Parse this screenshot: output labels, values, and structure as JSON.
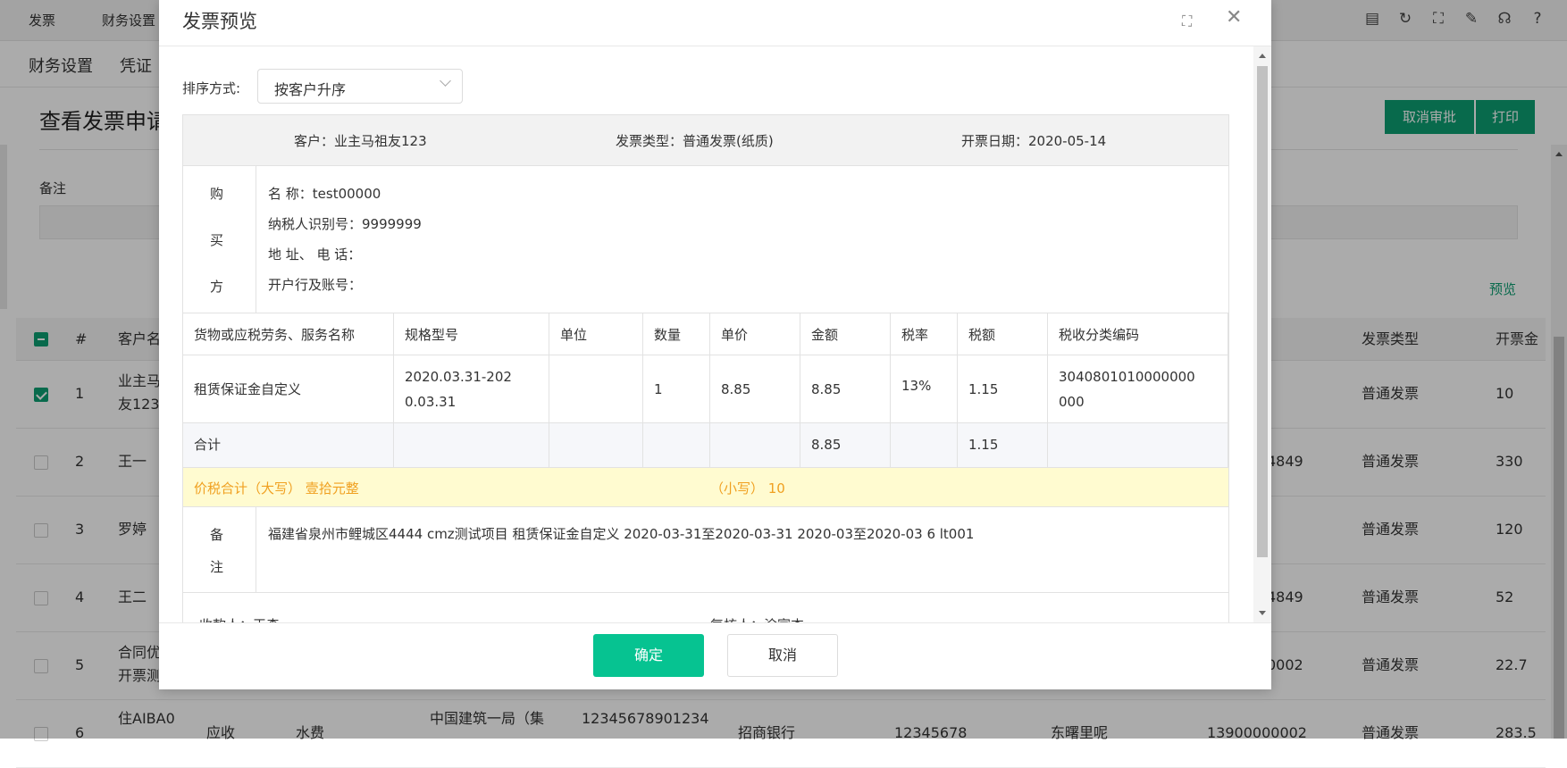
{
  "topnav": {
    "items": [
      "发票",
      "财务设置"
    ]
  },
  "subnav": {
    "items": [
      "财务设置",
      "凭证"
    ]
  },
  "page": {
    "title": "查看发票申请",
    "cancel_approve": "取消审批",
    "print": "打印",
    "remark_label": "备注",
    "preview_link": "预览"
  },
  "bg_table": {
    "headers": {
      "num": "#",
      "customer": "客户名",
      "invoice_type": "发票类型",
      "amount": "开票金"
    },
    "rows": [
      {
        "num": "1",
        "customer": [
          "业主马",
          "友123"
        ],
        "extra": "",
        "invoice_type": "普通发票",
        "amount": "10",
        "checked": true
      },
      {
        "num": "2",
        "customer": [
          "王一"
        ],
        "extra": "4849",
        "invoice_type": "普通发票",
        "amount": "330",
        "checked": false
      },
      {
        "num": "3",
        "customer": [
          "罗婷"
        ],
        "extra": "",
        "invoice_type": "普通发票",
        "amount": "120",
        "checked": false
      },
      {
        "num": "4",
        "customer": [
          "王二"
        ],
        "extra": "4849",
        "invoice_type": "普通发票",
        "amount": "52",
        "checked": false
      },
      {
        "num": "5",
        "customer": [
          "合同优",
          "开票测"
        ],
        "extra": "0002",
        "invoice_type": "普通发票",
        "amount": "22.7",
        "checked": false
      },
      {
        "num": "6",
        "customer": [
          "住AIBA0"
        ],
        "extra": "13900000002",
        "invoice_type": "普通发票",
        "amount": "283.5",
        "checked": false,
        "cols": [
          "应收",
          "水费",
          "中国建筑一局（集",
          "12345678901234",
          "招商银行",
          "12345678",
          "东曙里呢"
        ]
      }
    ]
  },
  "modal": {
    "title": "发票预览",
    "sort_label": "排序方式:",
    "sort_value": "按客户升序",
    "invoice": {
      "customer": "客户：业主马祖友123",
      "type": "发票类型：普通发票(纸质)",
      "date": "开票日期：2020-05-14",
      "buyer_side": [
        "购",
        "买",
        "方"
      ],
      "buyer": {
        "name": "名  称：test00000",
        "tax_id": "纳税人识别号：9999999",
        "address": "地  址、 电  话：",
        "bank": "开户行及账号："
      },
      "columns": [
        "货物或应税劳务、服务名称",
        "规格型号",
        "单位",
        "数量",
        "单价",
        "金额",
        "税率",
        "税额",
        "税收分类编码"
      ],
      "item": {
        "name": "租赁保证金自定义",
        "spec": [
          "2020.03.31-202",
          "0.03.31"
        ],
        "unit": "",
        "qty": "1",
        "price": "8.85",
        "amount": "8.85",
        "rate": "13%",
        "tax": "1.15",
        "code": [
          "3040801010000000",
          "000"
        ]
      },
      "sum": {
        "label": "合计",
        "amount": "8.85",
        "tax": "1.15"
      },
      "total": {
        "upper": "价税合计（大写） 壹拾元整",
        "lower": "（小写） 10"
      },
      "remark_side": [
        "备",
        "注"
      ],
      "remark": "福建省泉州市鲤城区4444 cmz测试项目 租赁保证金自定义 2020-03-31至2020-03-31 2020-03至2020-03 6 lt001",
      "payee": "收款人：王森",
      "checker": "复核人：涂富杰"
    },
    "ok": "确定",
    "cancel": "取消"
  }
}
